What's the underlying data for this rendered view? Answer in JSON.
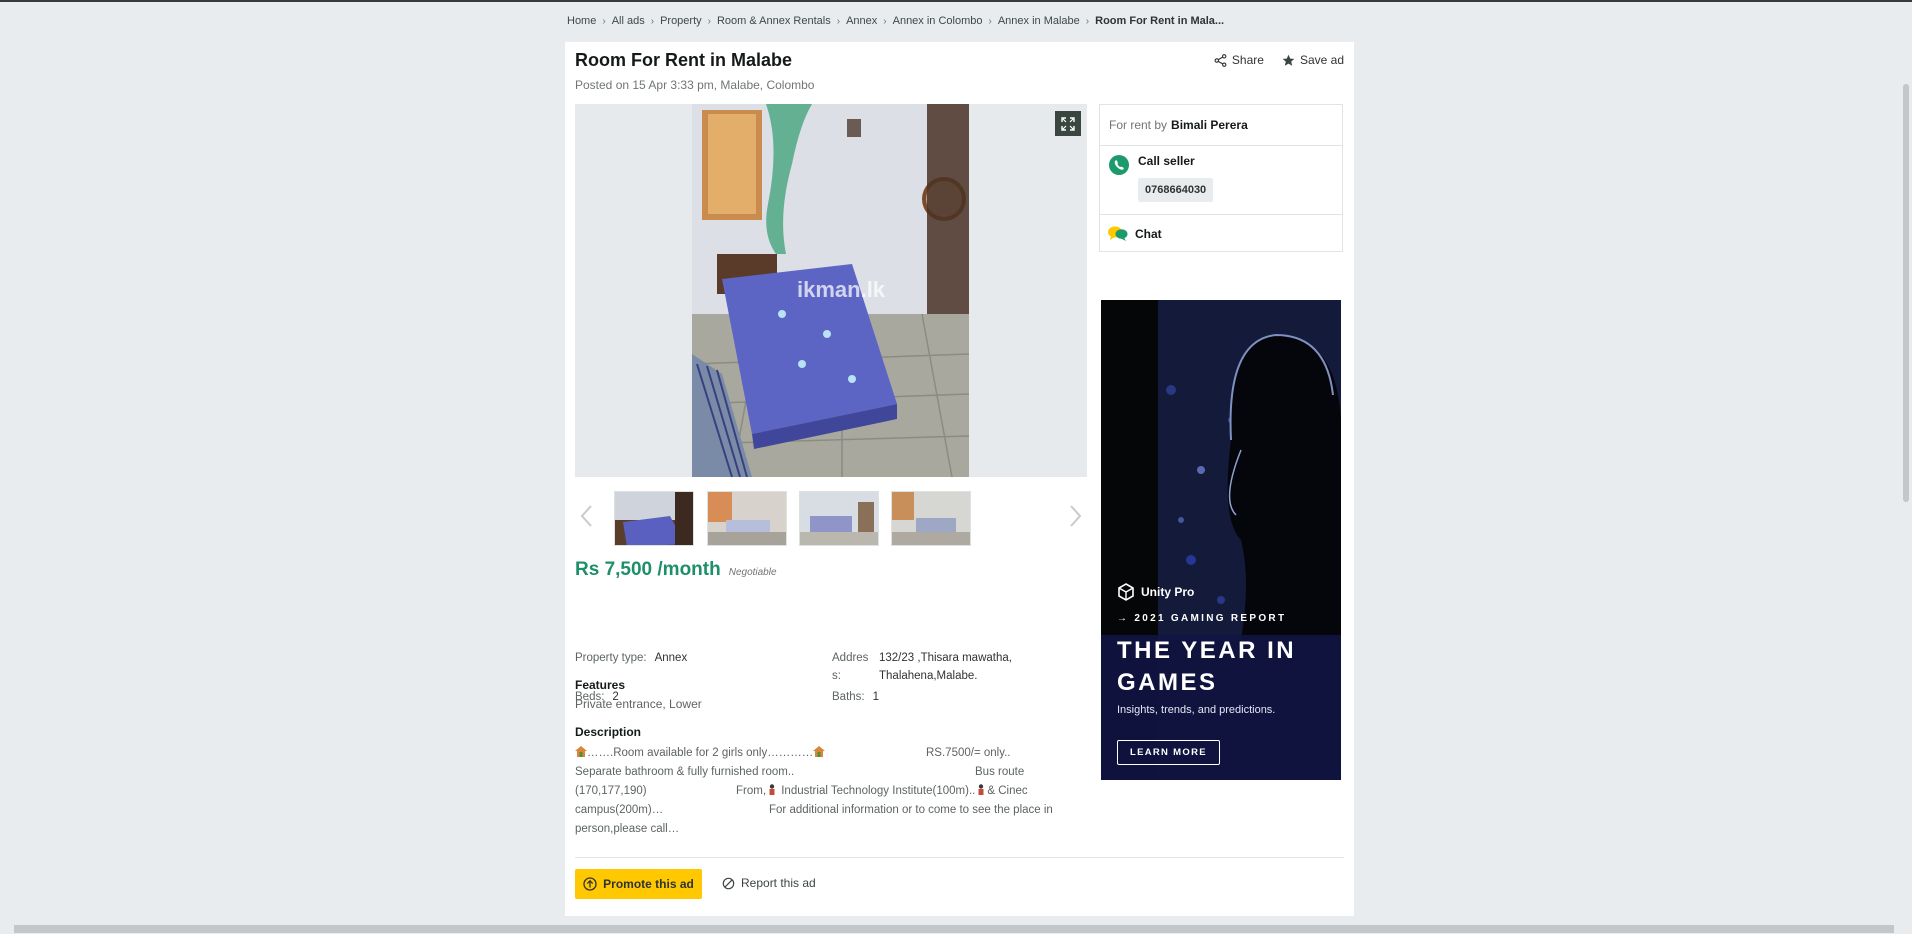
{
  "breadcrumb": [
    {
      "label": "Home"
    },
    {
      "label": "All ads"
    },
    {
      "label": "Property"
    },
    {
      "label": "Room & Annex Rentals"
    },
    {
      "label": "Annex"
    },
    {
      "label": "Annex in Colombo"
    },
    {
      "label": "Annex in Malabe"
    },
    {
      "label": "Room For Rent in Mala..."
    }
  ],
  "ad": {
    "title": "Room For Rent in Malabe",
    "posted": "Posted on 15 Apr 3:33 pm, Malabe, Colombo",
    "share_label": "Share",
    "save_label": "Save ad",
    "watermark": "ikman.lk",
    "price": "Rs 7,500 /month",
    "negotiable": "Negotiable",
    "properties": {
      "type_key": "Property type:",
      "type_val": "Annex",
      "address_key_1": "Addres",
      "address_key_2": "s:",
      "address_val_1": "132/23 ,Thisara mawatha,",
      "address_val_2": "Thalahena,Malabe.",
      "beds_key": "Beds:",
      "beds_val": "2",
      "baths_key": "Baths:",
      "baths_val": "1"
    },
    "features_heading": "Features",
    "features": "Private entrance, Lower",
    "description_heading": "Description",
    "description": {
      "l1a": "…….Room available for 2 girls only…………",
      "l1b": "RS.7500/= only..",
      "l2a": "Separate bathroom & fully furnished  room..",
      "l2b": "Bus route",
      "l3a": "(170,177,190)",
      "l3b": "From,",
      "l3c": " Industrial Technology Institute(100m)..",
      "l3d": "& Cinec",
      "l4a": "campus(200m)…",
      "l4b": "For additional information or to come to see the place in",
      "l5a": "person,please call…"
    },
    "promote_label": "Promote this ad",
    "report_label": "Report this ad"
  },
  "seller": {
    "for_rent_by": "For rent by",
    "name": "Bimali Perera",
    "call_label": "Call seller",
    "phone": "0768664030",
    "chat_label": "Chat"
  },
  "advert": {
    "brand": "Unity Pro",
    "subtitle": "→ 2021 GAMING REPORT",
    "title": "THE YEAR IN GAMES",
    "description": "Insights, trends, and predictions.",
    "button": "LEARN MORE"
  },
  "colors": {
    "accent_green": "#1d8f6a",
    "promote_yellow": "#ffc800",
    "page_bg": "#e8ecee"
  }
}
